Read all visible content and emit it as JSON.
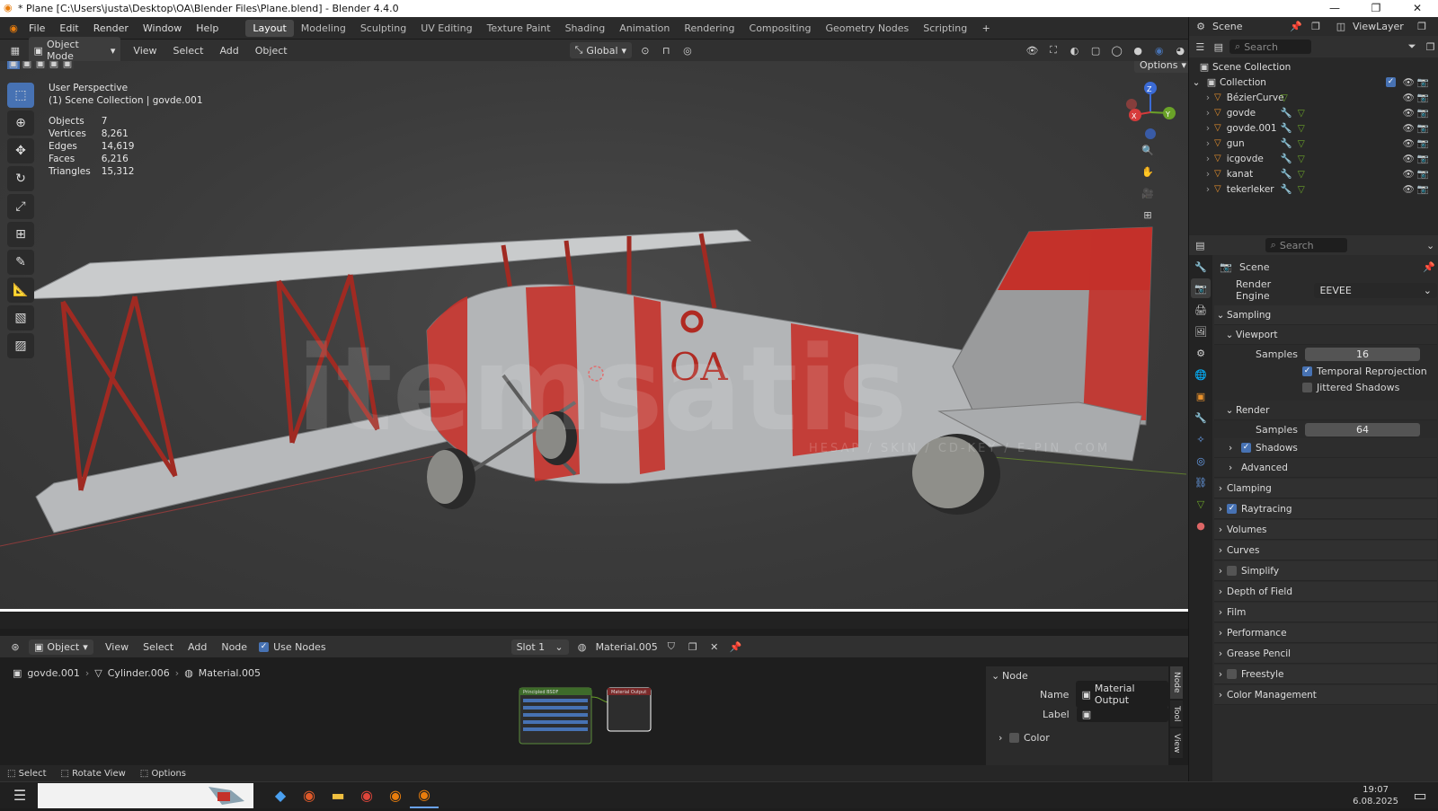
{
  "window": {
    "title": "* Plane [C:\\Users\\justa\\Desktop\\OA\\Blender Files\\Plane.blend] - Blender 4.4.0"
  },
  "menu": [
    "File",
    "Edit",
    "Render",
    "Window",
    "Help"
  ],
  "workspaces": [
    "Layout",
    "Modeling",
    "Sculpting",
    "UV Editing",
    "Texture Paint",
    "Shading",
    "Animation",
    "Rendering",
    "Compositing",
    "Geometry Nodes",
    "Scripting"
  ],
  "viewport_header": {
    "mode": "Object Mode",
    "menus": [
      "View",
      "Select",
      "Add",
      "Object"
    ],
    "orientation": "Global",
    "options": "Options"
  },
  "viewport": {
    "perspective": "User Perspective",
    "collection": "(1) Scene Collection | govde.001",
    "stats": [
      {
        "label": "Objects",
        "value": "7"
      },
      {
        "label": "Vertices",
        "value": "8,261"
      },
      {
        "label": "Edges",
        "value": "14,619"
      },
      {
        "label": "Faces",
        "value": "6,216"
      },
      {
        "label": "Triangles",
        "value": "15,312"
      }
    ],
    "fuselage_text": "OA",
    "watermark": "itemsatis",
    "watermark_sub": "HESAP / SKIN / CD-KEY / E-PIN .COM",
    "gizmo": {
      "x": "X",
      "y": "Y",
      "z": "Z"
    }
  },
  "outliner": {
    "scene": "Scene",
    "view_layer": "ViewLayer",
    "search_placeholder": "Search",
    "root": "Scene Collection",
    "collection": "Collection",
    "items": [
      "BézierCurve",
      "govde",
      "govde.001",
      "gun",
      "icgovde",
      "kanat",
      "tekerleker"
    ]
  },
  "properties": {
    "search_placeholder": "Search",
    "context": "Scene",
    "render_engine_label": "Render Engine",
    "render_engine": "EEVEE",
    "sampling": "Sampling",
    "viewport": "Viewport",
    "samples_label": "Samples",
    "viewport_samples": "16",
    "temporal": "Temporal Reprojection",
    "jittered": "Jittered Shadows",
    "render": "Render",
    "render_samples": "64",
    "shadows": "Shadows",
    "advanced": "Advanced",
    "sections": [
      "Clamping",
      "Raytracing",
      "Volumes",
      "Curves",
      "Simplify",
      "Depth of Field",
      "Film",
      "Performance",
      "Grease Pencil",
      "Freestyle",
      "Color Management"
    ]
  },
  "node_editor": {
    "type": "Object",
    "menus": [
      "View",
      "Select",
      "Add",
      "Node"
    ],
    "use_nodes": "Use Nodes",
    "slot": "Slot 1",
    "material": "Material.005",
    "breadcrumb": [
      "govde.001",
      "Cylinder.006",
      "Material.005"
    ],
    "panel": {
      "title": "Node",
      "name_label": "Name",
      "name": "Material Output",
      "label_label": "Label",
      "color": "Color"
    },
    "tabs": [
      "Node",
      "Tool",
      "View"
    ],
    "bsdf": "Principled BSDF",
    "output": "Material Output"
  },
  "status": {
    "select": "Select",
    "rotate": "Rotate View",
    "options": "Options"
  },
  "taskbar": {
    "time": "19:07",
    "date": "6.08.2025"
  }
}
